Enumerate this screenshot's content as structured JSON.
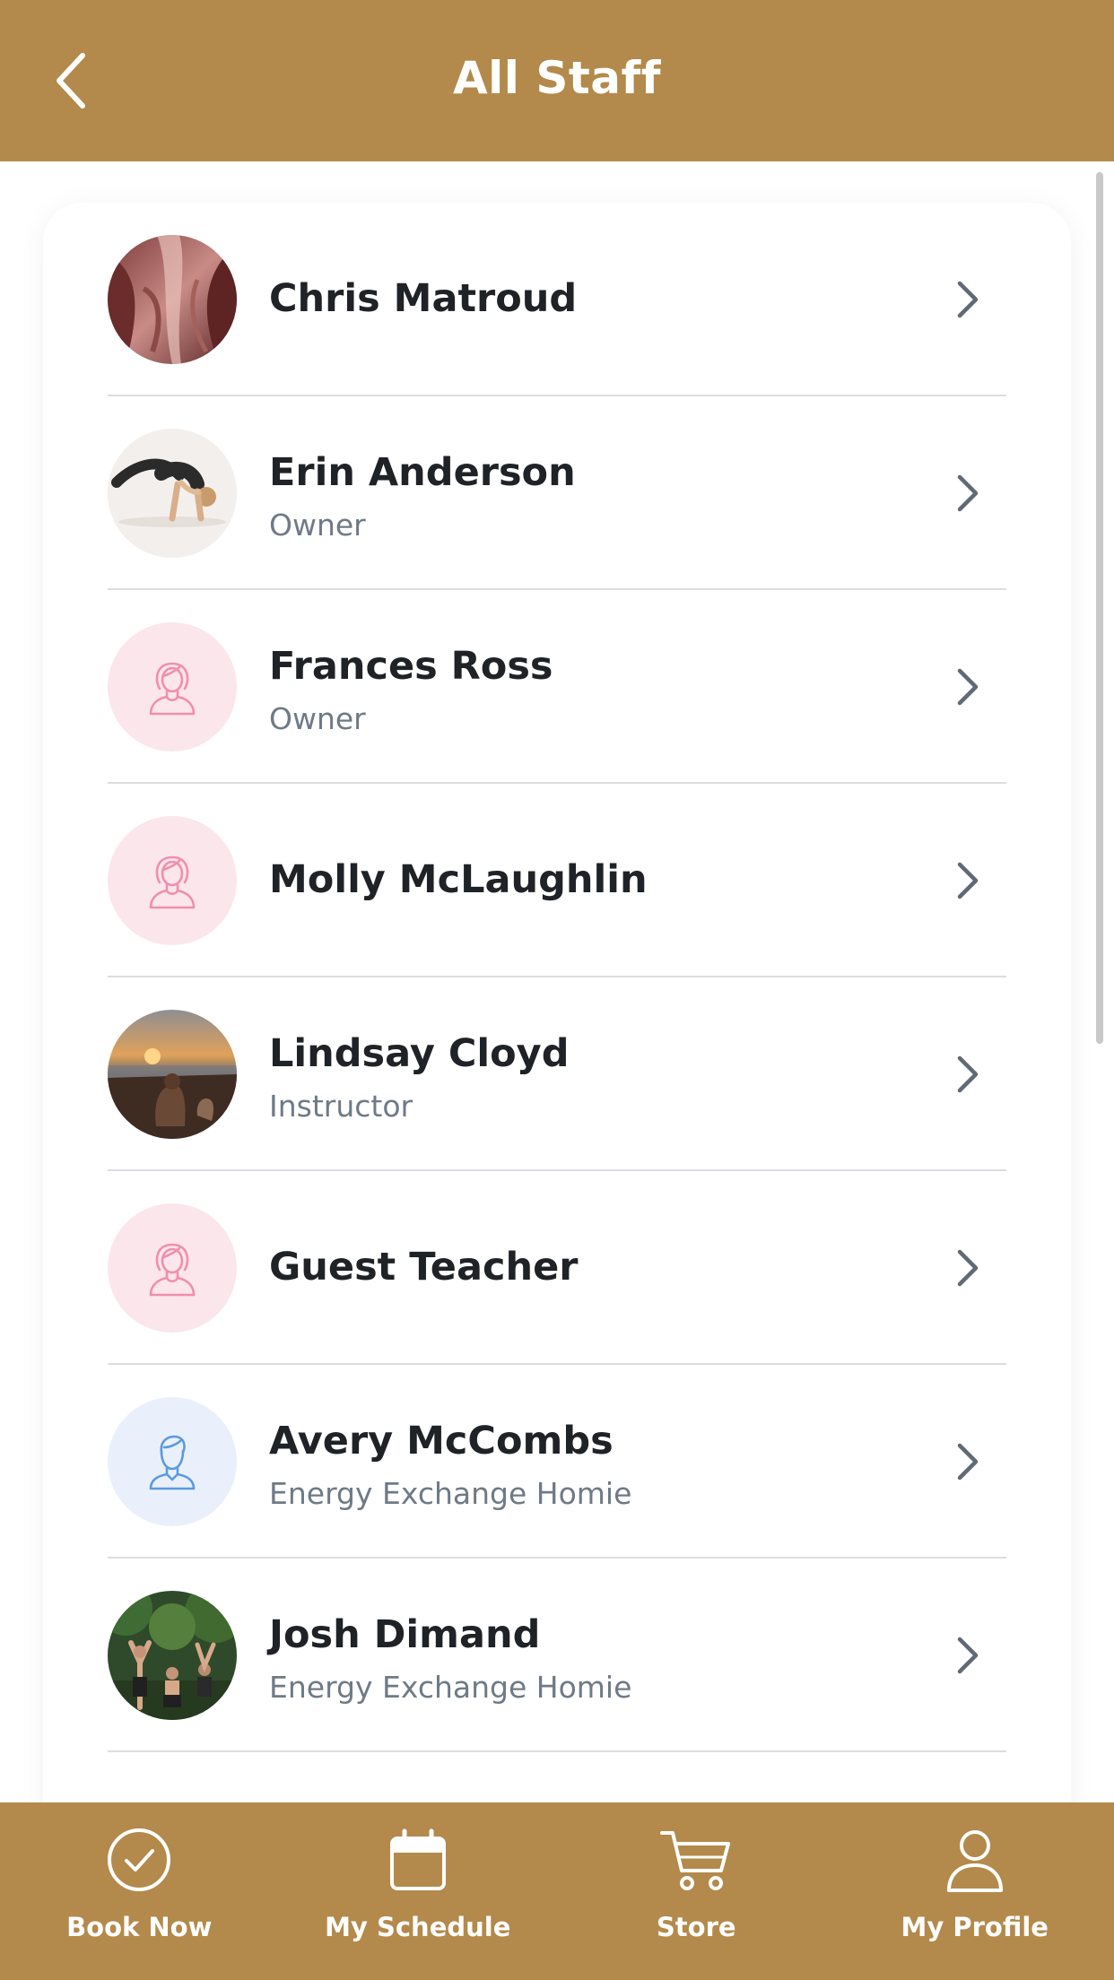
{
  "header": {
    "title": "All Staff",
    "back_icon": "chevron-left-icon"
  },
  "colors": {
    "brand": "#b38a4b",
    "text": "#1f2226",
    "subtext": "#6f7a86",
    "female_placeholder_bg": "#fbe6ec",
    "female_placeholder_icon": "#f08fab",
    "male_placeholder_bg": "#eaf0fb",
    "male_placeholder_icon": "#5b9ae0"
  },
  "staff": [
    {
      "name": "Chris Matroud",
      "role": "",
      "avatar": "photo-canyon"
    },
    {
      "name": "Erin Anderson",
      "role": "Owner",
      "avatar": "photo-yoga-pose"
    },
    {
      "name": "Frances Ross",
      "role": "Owner",
      "avatar": "female-placeholder-icon"
    },
    {
      "name": "Molly McLaughlin",
      "role": "",
      "avatar": "female-placeholder-icon"
    },
    {
      "name": "Lindsay Cloyd",
      "role": "Instructor",
      "avatar": "photo-sunset-beach"
    },
    {
      "name": "Guest Teacher",
      "role": "",
      "avatar": "female-placeholder-icon"
    },
    {
      "name": "Avery McCombs",
      "role": "Energy Exchange Homie",
      "avatar": "male-placeholder-icon"
    },
    {
      "name": "Josh Dimand",
      "role": "Energy Exchange Homie",
      "avatar": "photo-jungle-group"
    }
  ],
  "tabbar": {
    "tabs": [
      {
        "label": "Book Now",
        "icon": "check-circle-icon"
      },
      {
        "label": "My Schedule",
        "icon": "calendar-icon"
      },
      {
        "label": "Store",
        "icon": "cart-icon"
      },
      {
        "label": "My Profile",
        "icon": "person-icon"
      }
    ]
  }
}
